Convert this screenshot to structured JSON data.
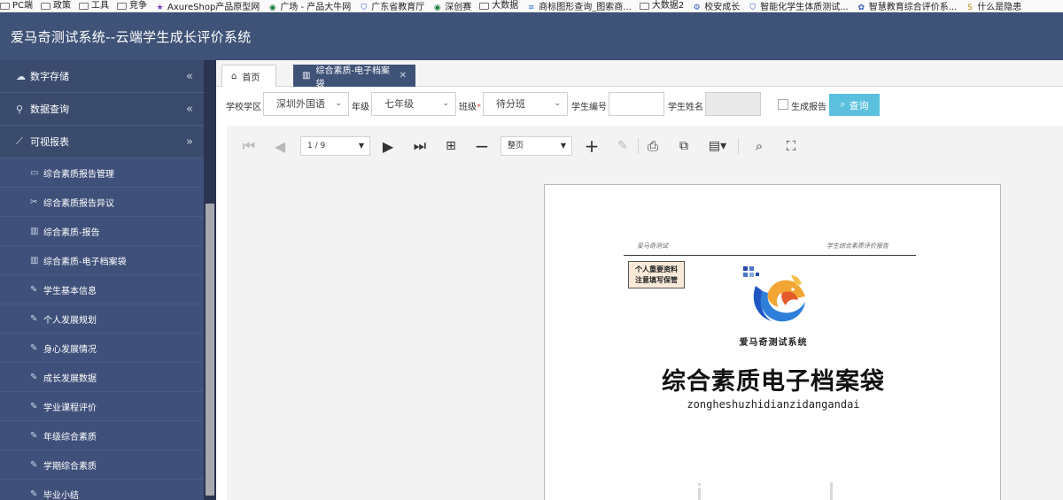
{
  "bookmarks": [
    {
      "label": "PC端",
      "icon": "folder-icon"
    },
    {
      "label": "政策",
      "icon": "folder-icon"
    },
    {
      "label": "工具",
      "icon": "folder-icon"
    },
    {
      "label": "竞争",
      "icon": "folder-icon"
    },
    {
      "label": "AxureShop产品原型网",
      "icon": "star-icon"
    },
    {
      "label": "广场 - 产品大牛网",
      "icon": "globe-icon"
    },
    {
      "label": "广东省教育厅",
      "icon": "shield-icon"
    },
    {
      "label": "深创赛",
      "icon": "globe-icon"
    },
    {
      "label": "大数据",
      "icon": "folder-icon"
    },
    {
      "label": "商标图形查询_图索商...",
      "icon": "wave-icon"
    },
    {
      "label": "大数据2",
      "icon": "folder-icon"
    },
    {
      "label": "校安成长",
      "icon": "gear-icon"
    },
    {
      "label": "智能化学生体质测试...",
      "icon": "shield-icon"
    },
    {
      "label": "智慧教育综合评价系...",
      "icon": "paw-icon"
    },
    {
      "label": "什么是隐患",
      "icon": "s-icon"
    }
  ],
  "header": {
    "title": "爱马奇测试系统--云端学生成长评价系统"
  },
  "sidebar": {
    "groups": [
      {
        "label": "数字存储",
        "icon": "cloud-icon",
        "chevron": "«"
      },
      {
        "label": "数据查询",
        "icon": "location-icon",
        "chevron": "«"
      },
      {
        "label": "可视报表",
        "icon": "line-chart-icon",
        "chevron": "»"
      }
    ],
    "items": [
      {
        "label": "综合素质报告管理",
        "icon": "book-icon"
      },
      {
        "label": "综合素质报告异议",
        "icon": "tools-icon"
      },
      {
        "label": "综合素质-报告",
        "icon": "bar-chart-icon"
      },
      {
        "label": "综合素质-电子档案袋",
        "icon": "bar-chart-icon"
      },
      {
        "label": "学生基本信息",
        "icon": "edit-icon"
      },
      {
        "label": "个人发展规划",
        "icon": "edit-icon"
      },
      {
        "label": "身心发展情况",
        "icon": "edit-icon"
      },
      {
        "label": "成长发展数据",
        "icon": "edit-icon"
      },
      {
        "label": "学业课程评价",
        "icon": "edit-icon"
      },
      {
        "label": "年级综合素质",
        "icon": "edit-icon"
      },
      {
        "label": "学期综合素质",
        "icon": "edit-icon"
      },
      {
        "label": "毕业小结",
        "icon": "edit-icon"
      }
    ]
  },
  "tabs": [
    {
      "label": "首页",
      "icon": "home-icon"
    },
    {
      "label": "综合素质-电子档案袋",
      "icon": "bar-chart-icon",
      "close": "✕"
    }
  ],
  "filters": {
    "school_label": "学校学区",
    "school_value": "深圳外国语",
    "grade_label": "年级",
    "grade_value": "七年级",
    "class_label": "班级",
    "class_required": "*",
    "class_value": "待分班",
    "student_no_label": "学生编号",
    "student_name_label": "学生姓名",
    "generate_report_label": "生成报告",
    "search_label": "查询"
  },
  "viewer": {
    "page_indicator": "1 / 9",
    "zoom_value": "整页"
  },
  "document": {
    "header_left": "爱马奇测试",
    "header_right": "学生综合素质评价报告",
    "stamp_line1": "个人重要资料",
    "stamp_line2": "注意填写保管",
    "system_name": "爱马奇测试系统",
    "title": "综合素质电子档案袋",
    "pinyin": "zongheshuzhidianzidangandai"
  }
}
